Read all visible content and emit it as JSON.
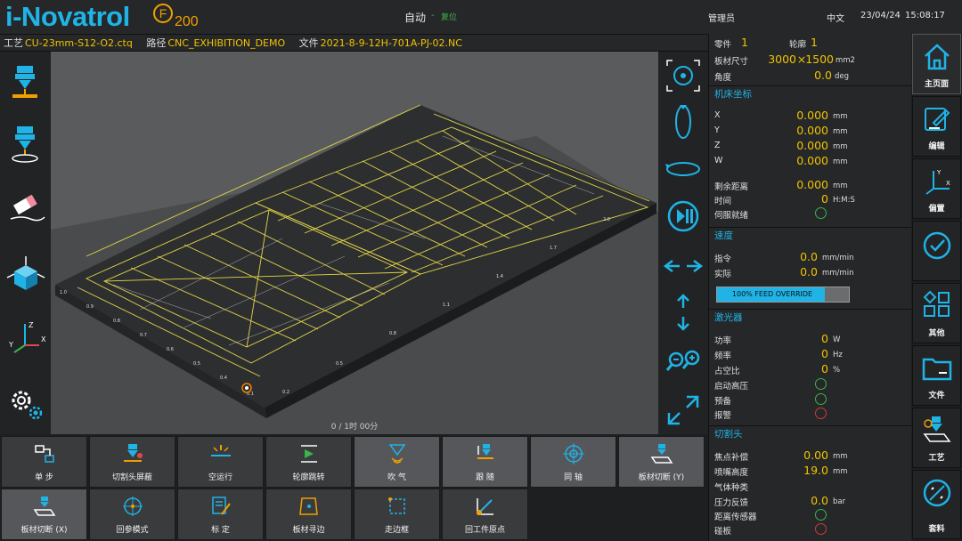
{
  "app": {
    "logo": "i-Novatrol",
    "logo_badge": "F",
    "logo_number": "200",
    "accent": "#1fb3e6",
    "value_color": "#f0c300"
  },
  "status": {
    "mode": "自动",
    "separator": "-",
    "reset": "复位",
    "user": "管理员",
    "language": "中文",
    "date": "23/04/24",
    "time": "15:08:17"
  },
  "file": {
    "process_label": "工艺",
    "process": "CU-23mm-S12-O2.ctq",
    "path_label": "路径",
    "path": "CNC_EXHIBITION_DEMO",
    "file_label": "文件",
    "file": "2021-8-9-12H-701A-PJ-02.NC"
  },
  "viewport": {
    "progress_text": "0 / 1时 00分"
  },
  "left_tools": [
    {
      "icon": "laser-head-down-icon"
    },
    {
      "icon": "laser-head-follow-icon"
    },
    {
      "icon": "eraser-icon"
    },
    {
      "icon": "3d-cube-view-icon"
    },
    {
      "icon": "axis-xyz-icon"
    },
    {
      "icon": "settings-gears-icon"
    }
  ],
  "view_tools": [
    {
      "icon": "locate-target-icon"
    },
    {
      "icon": "rotate-vertical-icon"
    },
    {
      "icon": "rotate-horizontal-icon"
    },
    {
      "icon": "play-pause-icon"
    },
    {
      "icon": "pan-horizontal-icon"
    },
    {
      "icon": "pan-vertical-icon"
    },
    {
      "icon": "zoom-icon"
    },
    {
      "icon": "fit-expand-icon"
    }
  ],
  "bottom_buttons": [
    {
      "label": "单 步"
    },
    {
      "label": "切割头屏蔽"
    },
    {
      "label": "空运行"
    },
    {
      "label": "轮廓跳转"
    },
    {
      "label": "吹 气"
    },
    {
      "label": "跟 随"
    },
    {
      "label": "同 轴"
    },
    {
      "label": "板材切断 (Y)"
    },
    {
      "label": "板材切断 (X)"
    },
    {
      "label": "回参模式"
    },
    {
      "label": "标 定"
    },
    {
      "label": "板材寻边"
    },
    {
      "label": "走边框"
    },
    {
      "label": "回工件原点"
    }
  ],
  "panel": {
    "part_label": "零件",
    "part": "1",
    "contour_label": "轮廓",
    "contour": "1",
    "sheet_label": "板材尺寸",
    "sheet_w": "3000",
    "sheet_x": "×",
    "sheet_h": "1500",
    "sheet_unit": "mm2",
    "angle_label": "角度",
    "angle": "0.0",
    "angle_unit": "deg",
    "coord_title": "机床坐标",
    "x_label": "X",
    "x": "0.000",
    "y_label": "Y",
    "y": "0.000",
    "z_label": "Z",
    "z": "0.000",
    "w_label": "W",
    "w": "0.000",
    "mm": "mm",
    "remain_label": "剩余距离",
    "remain": "0.000",
    "time_label": "时间",
    "time": "0",
    "time_unit": "H:M:S",
    "servo_label": "伺服就绪",
    "speed_title": "速度",
    "cmd_label": "指令",
    "cmd": "0.0",
    "act_label": "实际",
    "act": "0.0",
    "speed_unit": "mm/min",
    "feed_override": "100% FEED OVERRIDE",
    "feed_fraction": 0.82,
    "laser_title": "激光器",
    "power_label": "功率",
    "power": "0",
    "power_unit": "W",
    "freq_label": "频率",
    "freq": "0",
    "freq_unit": "Hz",
    "duty_label": "占空比",
    "duty": "0",
    "duty_unit": "%",
    "hv_label": "启动高压",
    "prep_label": "预备",
    "alarm_label": "报警",
    "head_title": "切割头",
    "focus_label": "焦点补偿",
    "focus": "0.00",
    "focus_unit": "mm",
    "nozzle_label": "喷嘴高度",
    "nozzle": "19.0",
    "nozzle_unit": "mm",
    "gas_label": "气体种类",
    "press_label": "压力反馈",
    "press": "0.0",
    "press_unit": "bar",
    "dist_label": "距离传感器",
    "collide_label": "碰板"
  },
  "nav": [
    {
      "label": "主页面",
      "icon": "home-icon"
    },
    {
      "label": "编辑",
      "icon": "edit-icon"
    },
    {
      "label": "偏置",
      "icon": "offset-axis-icon"
    },
    {
      "label": "",
      "icon": "check-circle-icon"
    },
    {
      "label": "其他",
      "icon": "other-shapes-icon"
    },
    {
      "label": "文件",
      "icon": "folder-icon"
    },
    {
      "label": "工艺",
      "icon": "process-laser-icon"
    },
    {
      "label": "套料",
      "icon": "nesting-icon"
    }
  ]
}
